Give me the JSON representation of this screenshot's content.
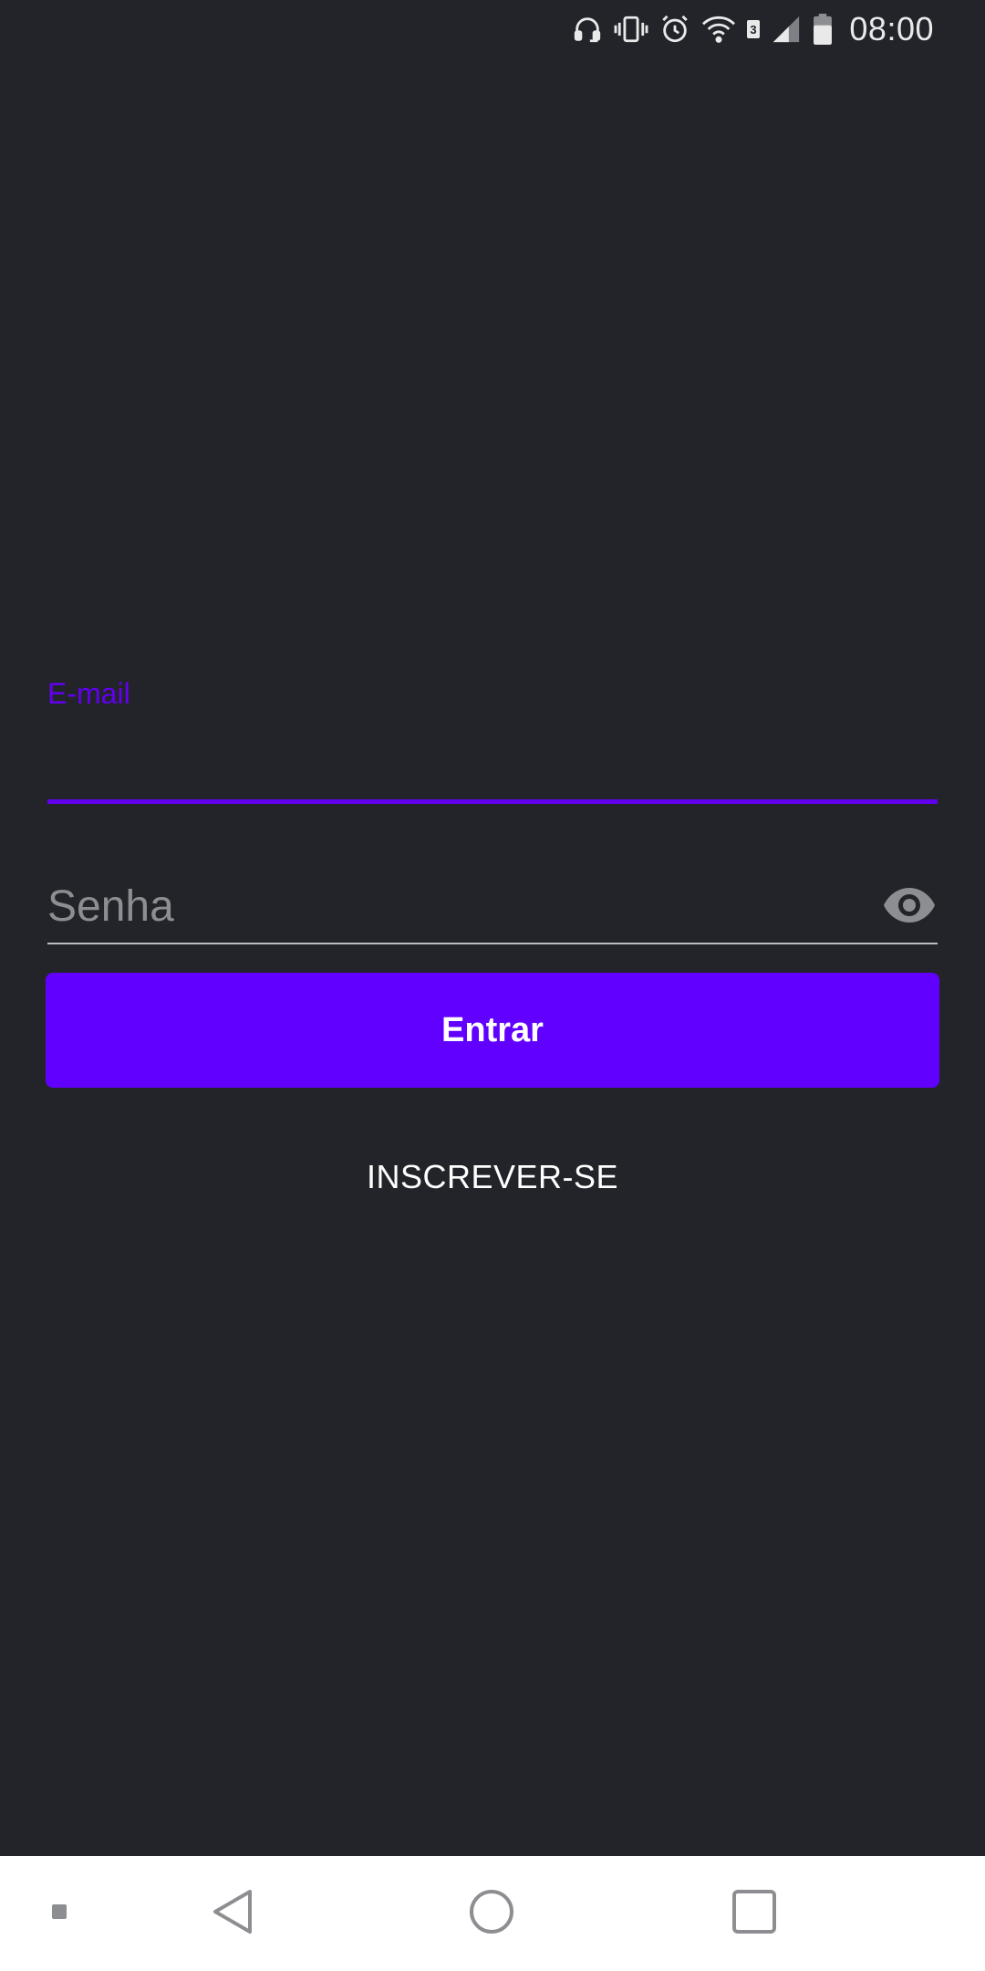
{
  "status_bar": {
    "time": "08:00",
    "icons": [
      "headset-icon",
      "vibrate-icon",
      "alarm-icon",
      "wifi-icon",
      "sim-3-icon",
      "signal-icon",
      "battery-icon"
    ]
  },
  "login_form": {
    "email_label": "E-mail",
    "email_value": "",
    "password_placeholder": "Senha",
    "password_value": "",
    "login_button_label": "Entrar",
    "signup_label": "INSCREVER-SE"
  },
  "nav_bar": {
    "items": [
      "dot-icon",
      "back-icon",
      "home-icon",
      "recents-icon"
    ]
  },
  "colors": {
    "background": "#22242a",
    "accent": "#6200ee",
    "button": "#6200ff",
    "nav_background": "#ffffff"
  }
}
